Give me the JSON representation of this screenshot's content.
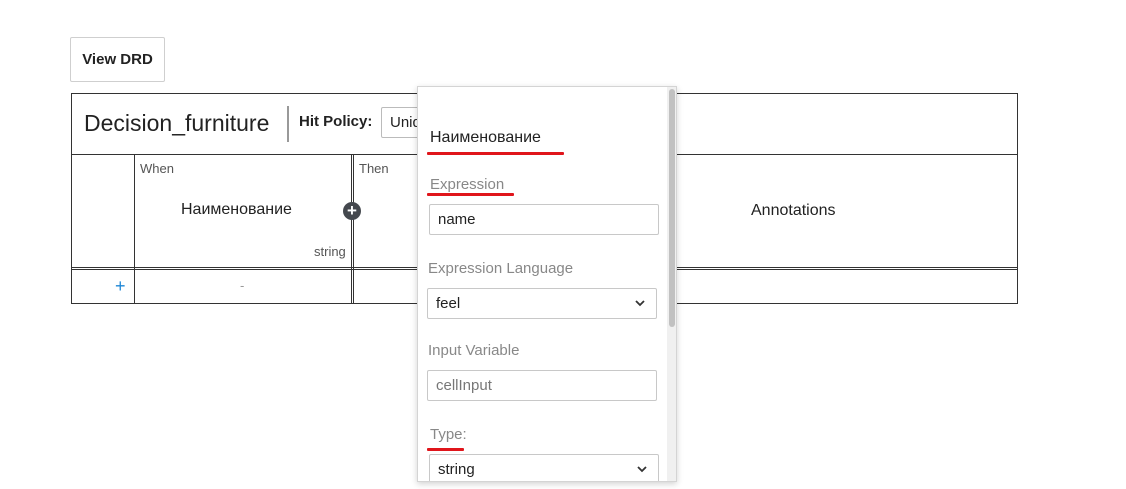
{
  "toolbar": {
    "view_drd_label": "View DRD"
  },
  "decision": {
    "name": "Decision_furniture",
    "hit_policy_label": "Hit Policy:",
    "hit_policy_value": "Unique"
  },
  "columns": {
    "input": {
      "kind_label": "When",
      "title": "Наименование",
      "type": "string"
    },
    "output": {
      "kind_label": "Then"
    },
    "annotations": {
      "title": "Annotations"
    }
  },
  "rows": [
    {
      "input_cell": "-"
    }
  ],
  "popup": {
    "title": "Наименование",
    "expression_label": "Expression",
    "expression_value": "name",
    "expression_language_label": "Expression Language",
    "expression_language_value": "feel",
    "input_variable_label": "Input Variable",
    "input_variable_placeholder": "cellInput",
    "type_label": "Type:",
    "type_value": "string"
  },
  "colors": {
    "highlight_underline": "#e0151b",
    "add_row": "#1f87d6"
  },
  "icons": {
    "add_column": "plus-circle-icon",
    "add_row": "plus-icon",
    "select_arrow": "chevron-down-icon"
  }
}
